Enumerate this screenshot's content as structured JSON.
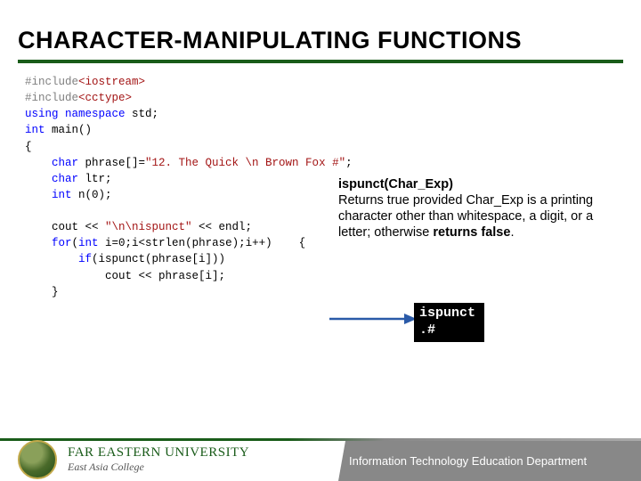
{
  "title": "CHARACTER-MANIPULATING FUNCTIONS",
  "code": {
    "l1_dir": "#include",
    "l1_inc": "<iostream>",
    "l2_dir": "#include",
    "l2_inc": "<cctype>",
    "l3_kw1": "using",
    "l3_kw2": "namespace",
    "l3_txt": " std;",
    "l4_type": "int",
    "l4_txt": " main()",
    "l5": "{",
    "l6_type": "    char",
    "l6_txt": " phrase[]=",
    "l6_str": "\"12. The Quick \\n Brown Fox #\"",
    "l6_end": ";",
    "l7_type": "    char",
    "l7_txt": " ltr;",
    "l8_type": "    int",
    "l8_txt": " n(0);",
    "l10_txt1": "    cout << ",
    "l10_str": "\"\\n\\nispunct\"",
    "l10_txt2": " << endl;",
    "l11_kw1": "    for",
    "l11_txt1": "(",
    "l11_type": "int",
    "l11_txt2": " i=0;i<strlen(phrase);i++)    {",
    "l12_kw1": "        if",
    "l12_txt": "(ispunct(phrase[i]))",
    "l13_txt": "            cout << phrase[i];",
    "l14": "    }"
  },
  "desc": {
    "fn": "ispunct(Char_Exp)",
    "body": "Returns true provided Char_Exp is a printing character other than whitespace, a digit, or a letter; otherwise ",
    "retfalse": "returns false",
    "period": "."
  },
  "output": {
    "line1": "ispunct",
    "line2": ".#"
  },
  "footer": {
    "uni_name": "FAR EASTERN UNIVERSITY",
    "uni_sub": "East Asia College",
    "dept": "Information Technology Education Department"
  }
}
